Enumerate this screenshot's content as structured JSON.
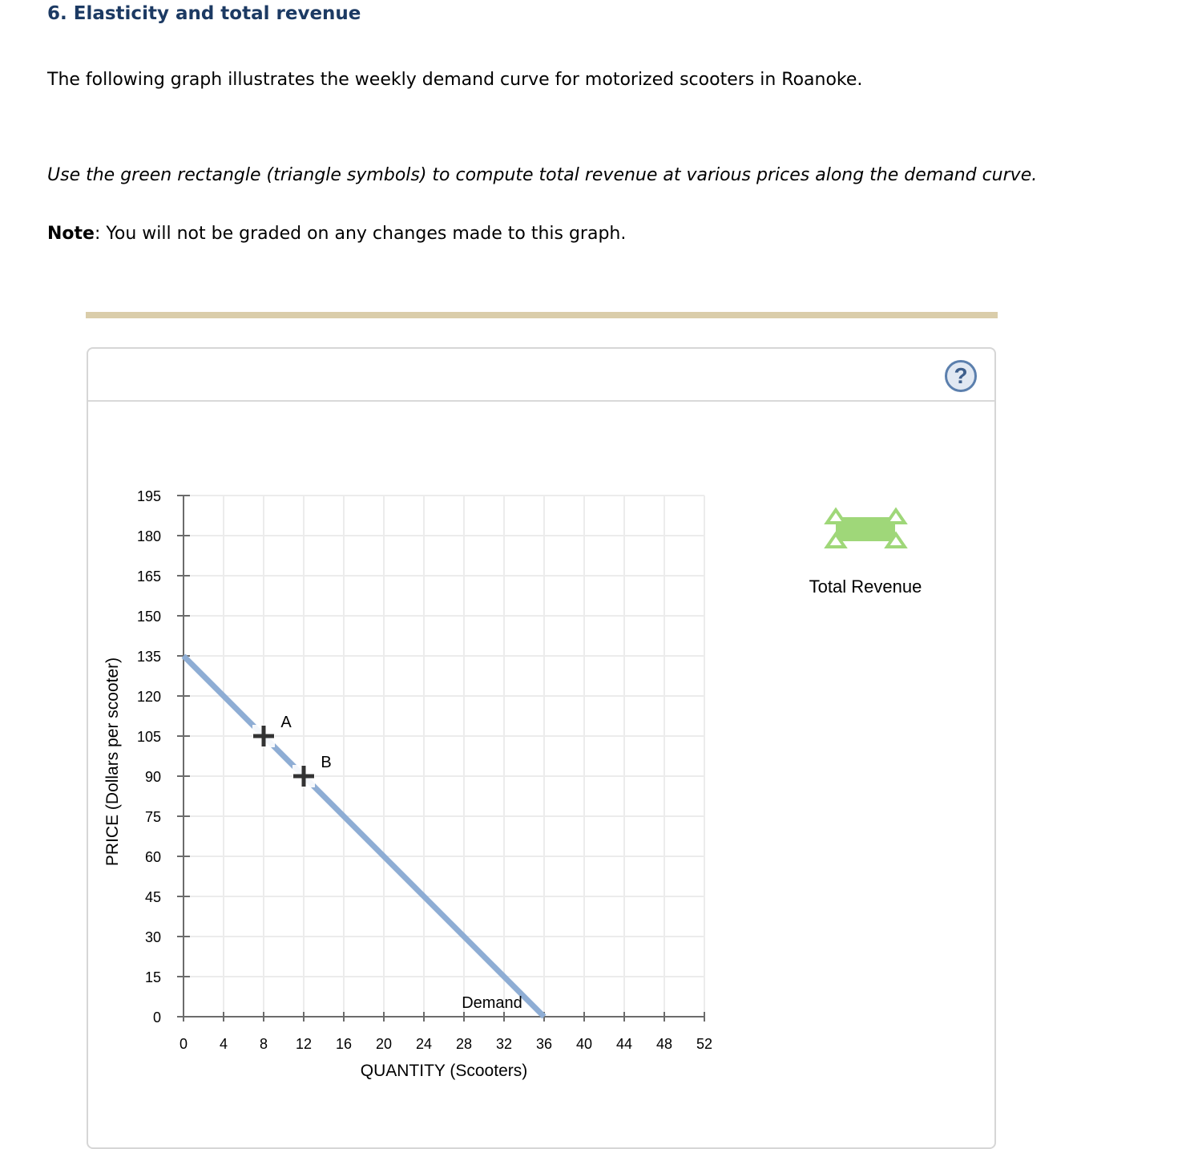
{
  "page": {
    "title": "6. Elasticity and total revenue",
    "intro": "The following graph illustrates the weekly demand curve for motorized scooters in Roanoke.",
    "instruction": "Use the green rectangle (triangle symbols) to compute total revenue at various prices along the demand curve.",
    "note_label": "Note",
    "note_text": ": You will not be graded on any changes made to this graph."
  },
  "panel": {
    "help_icon": "?",
    "legend": {
      "label": "Total Revenue",
      "icon": "green-rectangle-with-triangle-handles",
      "color": "#9fd779"
    }
  },
  "colors": {
    "title": "#1c3a63",
    "demand": "#8eadd4",
    "grid": "#ececec",
    "axis": "#6b6b6b",
    "point": "#333333",
    "tan_bar": "#dacdaa"
  },
  "chart_data": {
    "type": "line",
    "title": "",
    "xlabel": "QUANTITY (Scooters)",
    "ylabel": "PRICE (Dollars per scooter)",
    "xlim": [
      0,
      52
    ],
    "ylim": [
      0,
      195
    ],
    "x_ticks": [
      0,
      4,
      8,
      12,
      16,
      20,
      24,
      28,
      32,
      36,
      40,
      44,
      48,
      52
    ],
    "y_ticks": [
      0,
      15,
      30,
      45,
      60,
      75,
      90,
      105,
      120,
      135,
      150,
      165,
      180,
      195
    ],
    "grid": true,
    "series": [
      {
        "name": "Demand",
        "points": [
          [
            0,
            135
          ],
          [
            36,
            0
          ]
        ]
      }
    ],
    "points": [
      {
        "label": "A",
        "x": 8,
        "y": 105
      },
      {
        "label": "B",
        "x": 12,
        "y": 90
      }
    ],
    "annotations": [
      {
        "text": "Demand",
        "near": [
          36,
          0
        ]
      }
    ]
  }
}
